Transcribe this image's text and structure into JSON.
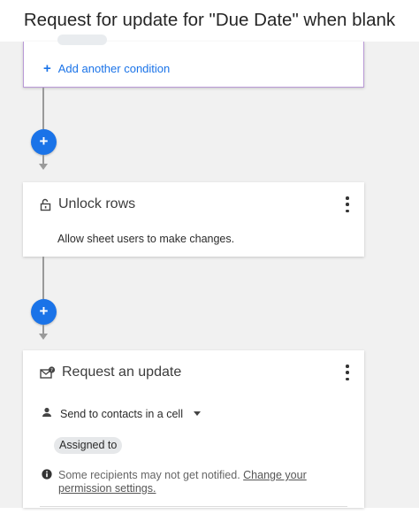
{
  "page": {
    "title": "Request for update for \"Due Date\" when blank"
  },
  "condition_card": {
    "add_condition_label": "Add another condition"
  },
  "workflow": {
    "add_step_label": "+"
  },
  "unlock_card": {
    "title": "Unlock rows",
    "description": "Allow sheet users to make changes.",
    "icon": "unlock-icon"
  },
  "request_card": {
    "title": "Request an update",
    "icon": "request-update-icon",
    "send_to": "Send to contacts in a cell",
    "contact_column": "Assigned to",
    "warning": "Some recipients may not get notified.",
    "warning_link": "Change your permission settings."
  },
  "colors": {
    "accent": "#1a73e8",
    "condition_border": "#b99ad6",
    "canvas": "#f1f1f1"
  }
}
